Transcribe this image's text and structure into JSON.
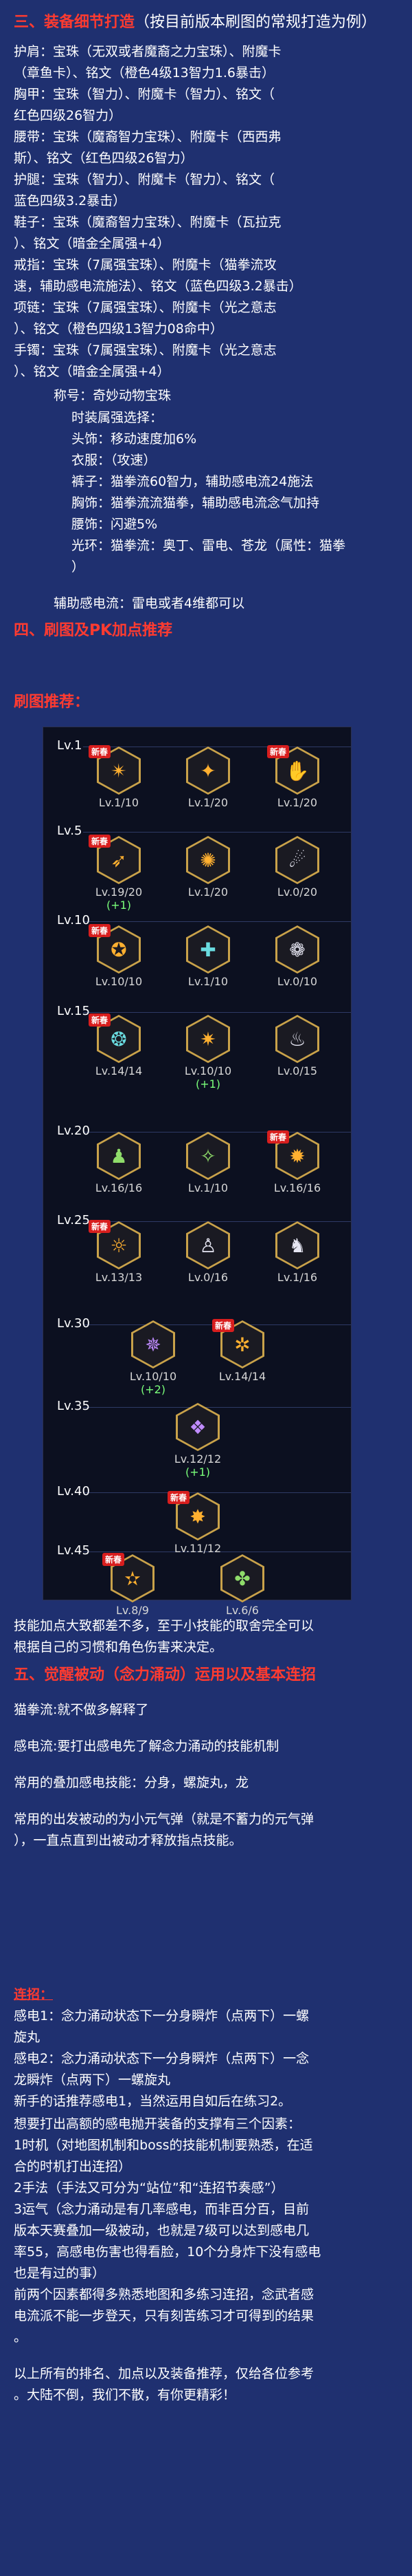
{
  "sections": {
    "s3": {
      "title": "三、装备细节打造",
      "subtitle": "（按目前版本刷图的常规打造为例）"
    },
    "s4": {
      "title": "四、刷图及PK加点推荐",
      "sub_title": "刷图推荐："
    },
    "s5": {
      "title": "五、觉醒被动（念力涌动）运用以及基本连招"
    }
  },
  "equipment_lines": [
    "护肩：宝珠（无双或者魔裔之力宝珠）、附魔卡",
    "（章鱼卡）、铭文（橙色4级13智力1.6暴击）",
    "胸甲：宝珠（智力）、附魔卡（智力）、铭文（",
    "红色四级26智力）",
    "腰带：宝珠（魔裔智力宝珠）、附魔卡（西西弗",
    "斯）、铭文（红色四级26智力）",
    "护腿：宝珠（智力）、附魔卡（智力）、铭文（",
    "蓝色四级3.2暴击）",
    "鞋子：宝珠（魔裔智力宝珠）、附魔卡（瓦拉克",
    "）、铭文（暗金全属强+4）",
    "戒指：宝珠（7属强宝珠）、附魔卡（猫拳流攻",
    "速，辅助感电流施法）、铭文（蓝色四级3.2暴击）",
    "项链：宝珠（7属强宝珠）、附魔卡（光之意志",
    "）、铭文（橙色四级13智力08命中）",
    "手镯：宝珠（7属强宝珠）、附魔卡（光之意志",
    "）、铭文（暗金全属强+4）"
  ],
  "title_line": "称号：奇妙动物宝珠",
  "fashion_header": "时装属强选择：",
  "fashion_lines": [
    "头饰：移动速度加6%",
    "衣服：（攻速）",
    "裤子：猫拳流60智力，辅助感电流24施法",
    "胸饰：猫拳流流猫拳，辅助感电流念气加持",
    "腰饰：闪避5%",
    "光环：猫拳流：奥丁、雷电、苍龙（属性：猫拳",
    "）"
  ],
  "assist_line": "辅助感电流：雷电或者4维都可以",
  "skill_panel": {
    "levels": [
      "Lv.1",
      "Lv.5",
      "Lv.10",
      "Lv.15",
      "Lv.20",
      "Lv.25",
      "Lv.30",
      "Lv.35",
      "Lv.40",
      "Lv.45"
    ],
    "badge": "新春",
    "rows": [
      {
        "items": [
          {
            "name": "a1",
            "lv": "Lv.1/10",
            "plus": "",
            "color": "gold",
            "badge": true,
            "glyph": "✴"
          },
          {
            "name": "a2",
            "lv": "Lv.1/20",
            "plus": "",
            "color": "gold",
            "badge": false,
            "glyph": "✦"
          },
          {
            "name": "a3",
            "lv": "Lv.1/20",
            "plus": "",
            "color": "white",
            "badge": true,
            "glyph": "✋"
          }
        ]
      },
      {
        "items": [
          {
            "name": "b1",
            "lv": "Lv.19/20",
            "plus": "(+1)",
            "color": "gold",
            "badge": true,
            "glyph": "➶"
          },
          {
            "name": "b2",
            "lv": "Lv.1/20",
            "plus": "",
            "color": "gold",
            "badge": false,
            "glyph": "✺"
          },
          {
            "name": "b3",
            "lv": "Lv.0/20",
            "plus": "",
            "color": "white",
            "badge": false,
            "glyph": "☄"
          }
        ]
      },
      {
        "items": [
          {
            "name": "c1",
            "lv": "Lv.10/10",
            "plus": "",
            "color": "gold",
            "badge": true,
            "glyph": "✪"
          },
          {
            "name": "c2",
            "lv": "Lv.1/10",
            "plus": "",
            "color": "teal",
            "badge": false,
            "glyph": "✚"
          },
          {
            "name": "c3",
            "lv": "Lv.0/10",
            "plus": "",
            "color": "white",
            "badge": false,
            "glyph": "❁"
          }
        ]
      },
      {
        "items": [
          {
            "name": "d1",
            "lv": "Lv.14/14",
            "plus": "",
            "color": "teal",
            "badge": true,
            "glyph": "❂"
          },
          {
            "name": "d2",
            "lv": "Lv.10/10",
            "plus": "(+1)",
            "color": "gold",
            "badge": false,
            "glyph": "✷"
          },
          {
            "name": "d3",
            "lv": "Lv.0/15",
            "plus": "",
            "color": "white",
            "badge": false,
            "glyph": "♨"
          }
        ]
      },
      {
        "items": [
          {
            "name": "e1",
            "lv": "Lv.16/16",
            "plus": "",
            "color": "green",
            "badge": false,
            "glyph": "♟"
          },
          {
            "name": "e2",
            "lv": "Lv.1/10",
            "plus": "",
            "color": "green",
            "badge": false,
            "glyph": "✧"
          },
          {
            "name": "e3",
            "lv": "Lv.16/16",
            "plus": "",
            "color": "gold",
            "badge": true,
            "glyph": "✹"
          }
        ]
      },
      {
        "items": [
          {
            "name": "f1",
            "lv": "Lv.13/13",
            "plus": "",
            "color": "gold",
            "badge": true,
            "glyph": "☼"
          },
          {
            "name": "f2",
            "lv": "Lv.0/16",
            "plus": "",
            "color": "white",
            "badge": false,
            "glyph": "♙"
          },
          {
            "name": "f3",
            "lv": "Lv.1/16",
            "plus": "",
            "color": "white",
            "badge": false,
            "glyph": "♞"
          }
        ]
      },
      {
        "items": [
          {
            "name": "g1",
            "lv": "Lv.10/10",
            "plus": "(+2)",
            "color": "purple",
            "badge": false,
            "glyph": "✵"
          },
          {
            "name": "g2",
            "lv": "Lv.14/14",
            "plus": "",
            "color": "gold",
            "badge": true,
            "glyph": "✲"
          }
        ]
      },
      {
        "items": [
          {
            "name": "h1",
            "lv": "Lv.12/12",
            "plus": "(+1)",
            "color": "purple",
            "badge": false,
            "glyph": "❖"
          }
        ]
      },
      {
        "items": [
          {
            "name": "i1",
            "lv": "Lv.11/12",
            "plus": "",
            "color": "gold",
            "badge": true,
            "glyph": "✸"
          }
        ]
      },
      {
        "items": [
          {
            "name": "j1",
            "lv": "Lv.8/9",
            "plus": "",
            "color": "gold",
            "badge": true,
            "glyph": "✫"
          },
          {
            "name": "j2",
            "lv": "Lv.6/6",
            "plus": "",
            "color": "green",
            "badge": false,
            "glyph": "✤"
          }
        ]
      }
    ]
  },
  "after_panel_lines": [
    "技能加点大致都差不多，至于小技能的取舍完全可以",
    "根据自己的习惯和角色伤害来决定。"
  ],
  "s5_lines": [
    "猫拳流:就不做多解释了",
    "感电流:要打出感电先了解念力涌动的技能机制",
    "常用的叠加感电技能：分身，螺旋丸，龙",
    "常用的出发被动的为小元气弹（就是不蓄力的元气弹",
    "），一直点直到出被动才释放指点技能。"
  ],
  "combo": {
    "title": "连招：",
    "lines": [
      "感电1：念力涌动状态下一分身瞬炸（点两下）一螺",
      "旋丸",
      "感电2：念力涌动状态下一分身瞬炸（点两下）一念",
      "龙瞬炸（点两下）一螺旋丸",
      "新手的话推荐感电1，当然运用自如后在练习2。"
    ]
  },
  "final_lines": [
    "想要打出高额的感电抛开装备的支撑有三个因素：",
    "1时机（对地图机制和boss的技能机制要熟悉，在适",
    "合的时机打出连招）",
    "2手法（手法又可分为“站位”和“连招节奏感”）",
    "3运气（念力涌动是有几率感电，而非百分百，目前",
    "版本天赛叠加一级被动，也就是7级可以达到感电几",
    "率55，高感电伤害也得看脸，10个分身炸下没有感电",
    "也是有过的事）",
    "前两个因素都得多熟悉地图和多练习连招，念武者感",
    "电流派不能一步登天，只有刻苦练习才可得到的结果",
    "。",
    "以上所有的排名、加点以及装备推荐，仅给各位参考",
    "。大陆不倒，我们不散，有你更精彩！"
  ]
}
